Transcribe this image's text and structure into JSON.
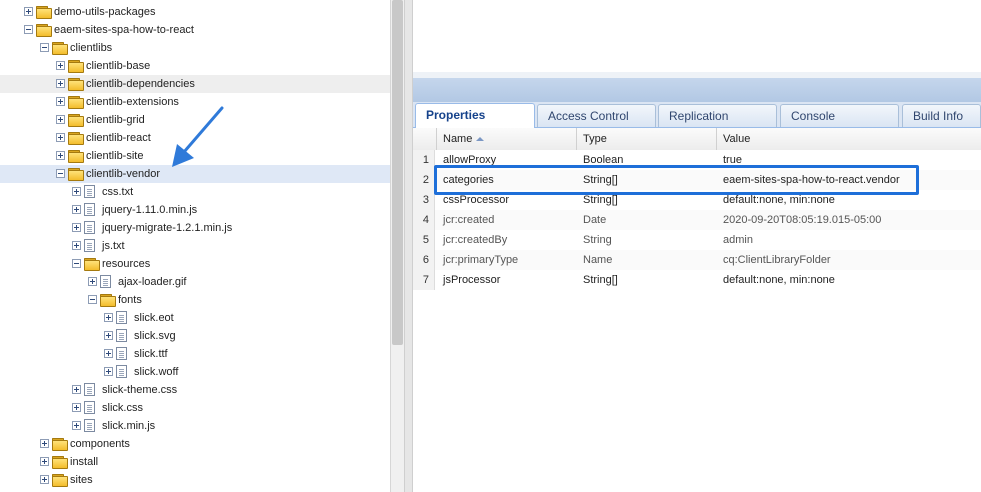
{
  "tree": {
    "nodes": [
      {
        "label": "demo-utils-packages",
        "depth": 2,
        "toggle": "plus",
        "icon": "folder"
      },
      {
        "label": "eaem-sites-spa-how-to-react",
        "depth": 2,
        "toggle": "minus",
        "icon": "folder"
      },
      {
        "label": "clientlibs",
        "depth": 3,
        "toggle": "minus",
        "icon": "folder"
      },
      {
        "label": "clientlib-base",
        "depth": 4,
        "toggle": "plus",
        "icon": "folder"
      },
      {
        "label": "clientlib-dependencies",
        "depth": 4,
        "toggle": "plus",
        "icon": "folder",
        "state": "hover"
      },
      {
        "label": "clientlib-extensions",
        "depth": 4,
        "toggle": "plus",
        "icon": "folder"
      },
      {
        "label": "clientlib-grid",
        "depth": 4,
        "toggle": "plus",
        "icon": "folder"
      },
      {
        "label": "clientlib-react",
        "depth": 4,
        "toggle": "plus",
        "icon": "folder"
      },
      {
        "label": "clientlib-site",
        "depth": 4,
        "toggle": "plus",
        "icon": "folder"
      },
      {
        "label": "clientlib-vendor",
        "depth": 4,
        "toggle": "minus",
        "icon": "folder",
        "state": "selected"
      },
      {
        "label": "css.txt",
        "depth": 5,
        "toggle": "plus",
        "icon": "file"
      },
      {
        "label": "jquery-1.11.0.min.js",
        "depth": 5,
        "toggle": "plus",
        "icon": "file"
      },
      {
        "label": "jquery-migrate-1.2.1.min.js",
        "depth": 5,
        "toggle": "plus",
        "icon": "file"
      },
      {
        "label": "js.txt",
        "depth": 5,
        "toggle": "plus",
        "icon": "file"
      },
      {
        "label": "resources",
        "depth": 5,
        "toggle": "minus",
        "icon": "folder"
      },
      {
        "label": "ajax-loader.gif",
        "depth": 6,
        "toggle": "plus",
        "icon": "file"
      },
      {
        "label": "fonts",
        "depth": 6,
        "toggle": "minus",
        "icon": "folder"
      },
      {
        "label": "slick.eot",
        "depth": 7,
        "toggle": "plus",
        "icon": "file"
      },
      {
        "label": "slick.svg",
        "depth": 7,
        "toggle": "plus",
        "icon": "file"
      },
      {
        "label": "slick.ttf",
        "depth": 7,
        "toggle": "plus",
        "icon": "file"
      },
      {
        "label": "slick.woff",
        "depth": 7,
        "toggle": "plus",
        "icon": "file"
      },
      {
        "label": "slick-theme.css",
        "depth": 5,
        "toggle": "plus",
        "icon": "file"
      },
      {
        "label": "slick.css",
        "depth": 5,
        "toggle": "plus",
        "icon": "file"
      },
      {
        "label": "slick.min.js",
        "depth": 5,
        "toggle": "plus",
        "icon": "file"
      },
      {
        "label": "components",
        "depth": 3,
        "toggle": "plus",
        "icon": "folder"
      },
      {
        "label": "install",
        "depth": 3,
        "toggle": "plus",
        "icon": "folder"
      },
      {
        "label": "sites",
        "depth": 3,
        "toggle": "plus",
        "icon": "folder"
      }
    ]
  },
  "tabs": [
    {
      "label": "Properties",
      "active": true
    },
    {
      "label": "Access Control",
      "active": false
    },
    {
      "label": "Replication",
      "active": false
    },
    {
      "label": "Console",
      "active": false
    },
    {
      "label": "Build Info",
      "active": false
    }
  ],
  "grid": {
    "columns": {
      "name": "Name",
      "type": "Type",
      "value": "Value"
    },
    "sort": "name-ascending",
    "rows": [
      {
        "num": "1",
        "name": "allowProxy",
        "type": "Boolean",
        "value": "true",
        "protected": false
      },
      {
        "num": "2",
        "name": "categories",
        "type": "String[]",
        "value": "eaem-sites-spa-how-to-react.vendor",
        "protected": false,
        "highlighted": true
      },
      {
        "num": "3",
        "name": "cssProcessor",
        "type": "String[]",
        "value": "default:none, min:none",
        "protected": false
      },
      {
        "num": "4",
        "name": "jcr:created",
        "type": "Date",
        "value": "2020-09-20T08:05:19.015-05:00",
        "protected": true
      },
      {
        "num": "5",
        "name": "jcr:createdBy",
        "type": "String",
        "value": "admin",
        "protected": true
      },
      {
        "num": "6",
        "name": "jcr:primaryType",
        "type": "Name",
        "value": "cq:ClientLibraryFolder",
        "protected": true
      },
      {
        "num": "7",
        "name": "jsProcessor",
        "type": "String[]",
        "value": "default:none, min:none",
        "protected": false
      }
    ]
  },
  "annotations": {
    "arrow_color": "#2f7ad9",
    "highlight_color": "#1e6fd9",
    "selection_color": "#dfe8f6"
  }
}
